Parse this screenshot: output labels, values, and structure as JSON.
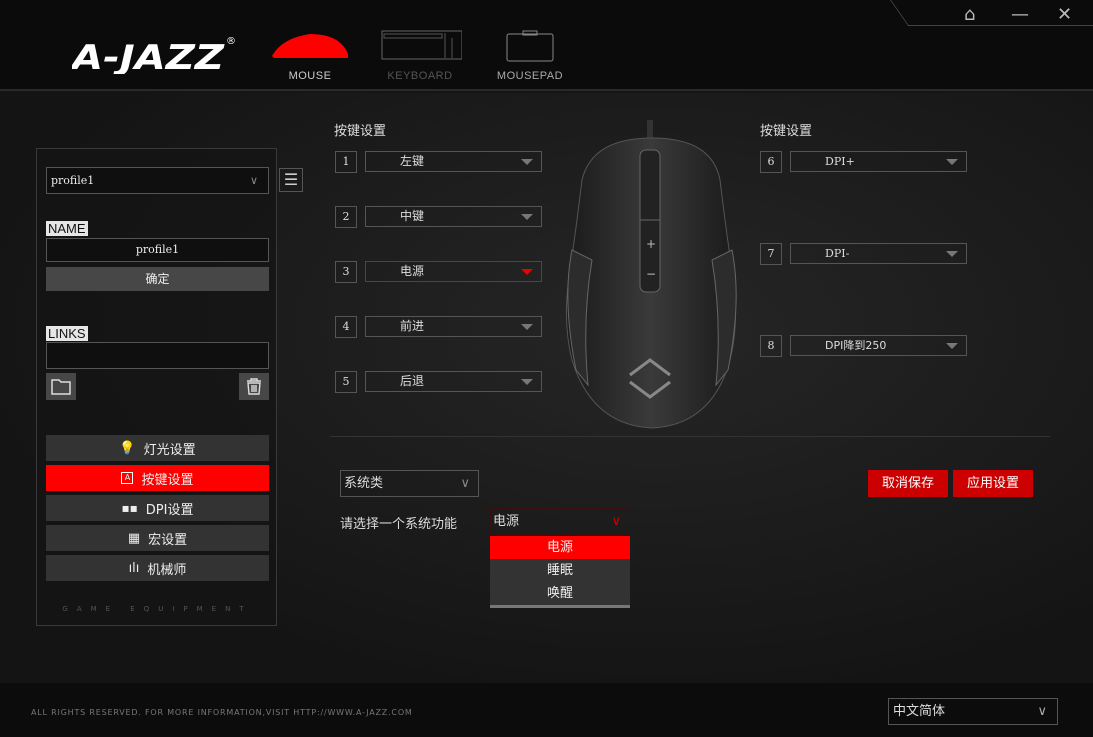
{
  "header": {
    "logo": "A-JAZZ®",
    "tabs": [
      {
        "label": "MOUSE",
        "active": true
      },
      {
        "label": "KEYBOARD",
        "active": false
      },
      {
        "label": "MOUSEPAD",
        "active": false
      }
    ],
    "window_icons": [
      "home-icon",
      "minimize-icon",
      "close-icon"
    ]
  },
  "sidebar": {
    "profile_select": "profile1",
    "name_label": "NAME",
    "name_value": "profile1",
    "confirm_label": "确定",
    "links_label": "LINKS",
    "links_value": "",
    "menu": [
      {
        "label": "灯光设置",
        "icon": "bulb-icon",
        "active": false
      },
      {
        "label": "按键设置",
        "icon": "key-icon",
        "active": true
      },
      {
        "label": "DPI设置",
        "icon": "grid-icon",
        "active": false
      },
      {
        "label": "宏设置",
        "icon": "calculator-icon",
        "active": false
      },
      {
        "label": "机械师",
        "icon": "equalizer-icon",
        "active": false
      }
    ],
    "tagline": "GAME EQUIPMENT"
  },
  "keys": {
    "left_title": "按键设置",
    "right_title": "按键设置",
    "left": [
      {
        "n": "1",
        "v": "左键"
      },
      {
        "n": "2",
        "v": "中键"
      },
      {
        "n": "3",
        "v": "电源",
        "highlight": true
      },
      {
        "n": "4",
        "v": "前进"
      },
      {
        "n": "5",
        "v": "后退"
      }
    ],
    "right": [
      {
        "n": "6",
        "v": "DPI+"
      },
      {
        "n": "7",
        "v": "DPI-"
      },
      {
        "n": "8",
        "v": "DPI降到250"
      }
    ]
  },
  "function": {
    "category": "系统类",
    "prompt": "请选择一个系统功能",
    "selected": "电源",
    "options": [
      "电源",
      "睡眠",
      "唤醒"
    ]
  },
  "actions": {
    "cancel": "取消保存",
    "apply": "应用设置"
  },
  "footer": {
    "copyright": "ALL RIGHTS RESERVED. FOR MORE INFORMATION,VISIT HTTP://WWW.A-JAZZ.COM",
    "language": "中文简体"
  },
  "colors": {
    "accent": "#ff0000"
  }
}
